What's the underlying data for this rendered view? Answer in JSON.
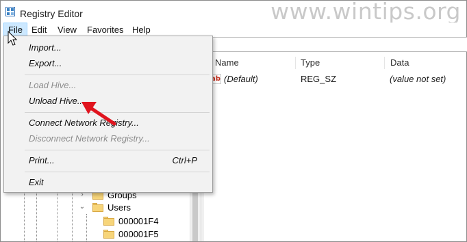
{
  "window": {
    "title": "Registry Editor",
    "watermark": "www.wintips.org",
    "app_icon": "registry-editor-icon"
  },
  "menubar": {
    "items": [
      {
        "label": "File"
      },
      {
        "label": "Edit"
      },
      {
        "label": "View"
      },
      {
        "label": "Favorites"
      },
      {
        "label": "Help"
      }
    ]
  },
  "file_menu": {
    "items": [
      {
        "label": "Import...",
        "enabled": true
      },
      {
        "label": "Export...",
        "enabled": true
      },
      {
        "label": "Load Hive...",
        "enabled": false
      },
      {
        "label": "Unload Hive...",
        "enabled": true
      },
      {
        "label": "Connect Network Registry...",
        "enabled": true
      },
      {
        "label": "Disconnect Network Registry...",
        "enabled": false
      },
      {
        "label": "Print...",
        "enabled": true,
        "shortcut": "Ctrl+P"
      },
      {
        "label": "Exit",
        "enabled": true
      }
    ]
  },
  "list": {
    "columns": [
      "Name",
      "Type",
      "Data"
    ],
    "rows": [
      {
        "name": "(Default)",
        "type": "REG_SZ",
        "data": "(value not set)",
        "icon": "string-value-ab-icon"
      }
    ]
  },
  "tree": {
    "items": [
      {
        "label": "Groups",
        "expanded": false
      },
      {
        "label": "Users",
        "expanded": true
      },
      {
        "label": "000001F4"
      },
      {
        "label": "000001F5"
      }
    ]
  },
  "colors": {
    "menu_highlight": "#cce8ff",
    "menu_bg": "#f2f2f2",
    "arrow": "#e0141e",
    "folder": "#f7d57a"
  }
}
